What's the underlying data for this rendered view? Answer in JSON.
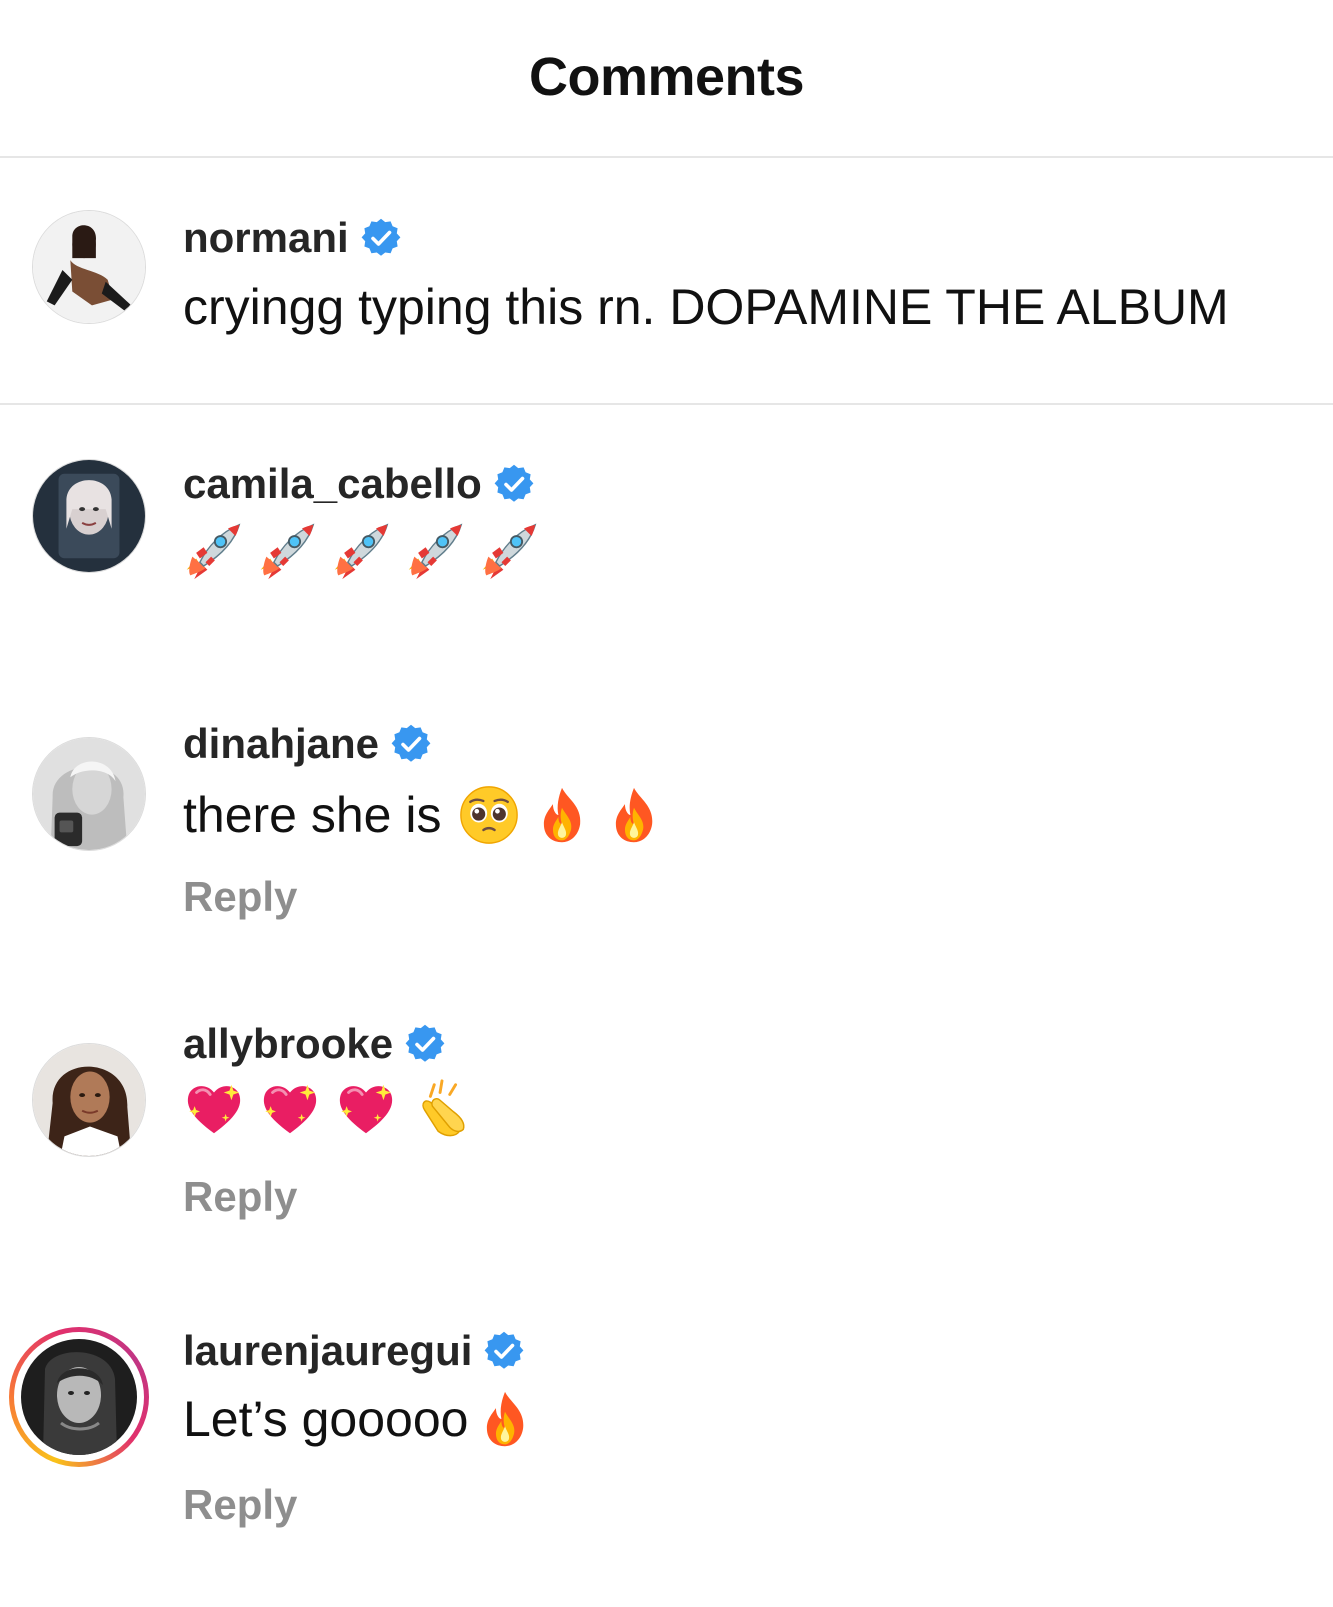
{
  "header": {
    "title": "Comments"
  },
  "comments": [
    {
      "username": "normani",
      "text": "cryingg typing this rn. DOPAMINE THE ALBUM",
      "verified": true
    },
    {
      "username": "camila_cabello",
      "emojis": [
        "rocket",
        "rocket",
        "rocket",
        "rocket",
        "rocket"
      ],
      "verified": true
    },
    {
      "username": "dinahjane",
      "text": "there she is",
      "emojis": [
        "pleading-face",
        "fire",
        "fire"
      ],
      "reply_label": "Reply",
      "verified": true
    },
    {
      "username": "allybrooke",
      "emojis": [
        "sparkling-heart",
        "sparkling-heart",
        "sparkling-heart",
        "clapping-hands"
      ],
      "reply_label": "Reply",
      "verified": true
    },
    {
      "username": "laurenjauregui",
      "text": "Let’s gooooo",
      "emojis": [
        "fire"
      ],
      "reply_label": "Reply",
      "verified": true,
      "has_story": true
    }
  ],
  "colors": {
    "verified": "#3897f0",
    "reply": "#8e8e8e",
    "divider": "#e6e6e6"
  }
}
